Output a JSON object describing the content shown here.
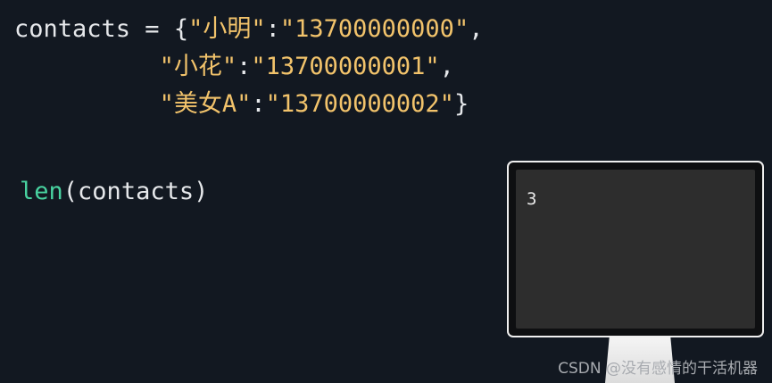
{
  "code": {
    "line1": {
      "var": "contacts",
      "op": " = ",
      "open_brace": "{",
      "key1": "\"小明\"",
      "colon1": ":",
      "val1": "\"13700000000\"",
      "comma1": ","
    },
    "line2": {
      "indent": "          ",
      "key2": "\"小花\"",
      "colon2": ":",
      "val2": "\"13700000001\"",
      "comma2": ","
    },
    "line3": {
      "indent": "          ",
      "key3": "\"美女A\"",
      "colon3": ":",
      "val3": "\"13700000002\"",
      "close_brace": "}"
    },
    "line4": {
      "fn": "len",
      "open_paren": "(",
      "arg": "contacts",
      "close_paren": ")"
    }
  },
  "monitor": {
    "output": "3"
  },
  "watermark": "CSDN @没有感情的干活机器",
  "colors": {
    "background": "#121821",
    "string": "#f2c36b",
    "function": "#48d2a0",
    "text": "#e6e8eb"
  }
}
